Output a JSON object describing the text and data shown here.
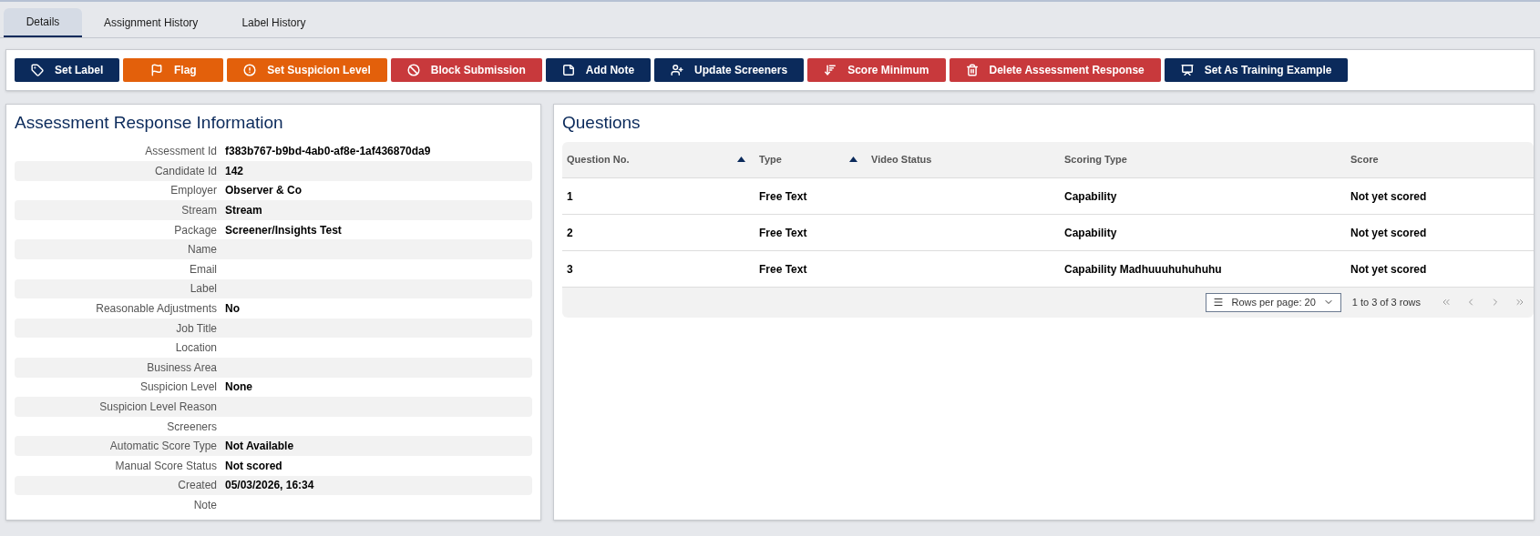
{
  "tabs": [
    {
      "label": "Details",
      "selected": true
    },
    {
      "label": "Assignment History",
      "selected": false
    },
    {
      "label": "Label History",
      "selected": false
    }
  ],
  "toolbar": [
    {
      "label": "Set Label",
      "kind": "primary"
    },
    {
      "label": "Flag",
      "kind": "warning"
    },
    {
      "label": "Set Suspicion Level",
      "kind": "warning"
    },
    {
      "label": "Block Submission",
      "kind": "danger"
    },
    {
      "label": "Add Note",
      "kind": "primary"
    },
    {
      "label": "Update Screeners",
      "kind": "primary"
    },
    {
      "label": "Score Minimum",
      "kind": "danger"
    },
    {
      "label": "Delete Assessment Response",
      "kind": "danger"
    },
    {
      "label": "Set As Training Example",
      "kind": "primary"
    }
  ],
  "info_panel": {
    "title": "Assessment Response Information",
    "fields": [
      {
        "label": "Assessment Id",
        "value": "f383b767-b9bd-4ab0-af8e-1af436870da9"
      },
      {
        "label": "Candidate Id",
        "value": "142"
      },
      {
        "label": "Employer",
        "value": "Observer & Co"
      },
      {
        "label": "Stream",
        "value": "Stream"
      },
      {
        "label": "Package",
        "value": "Screener/Insights Test"
      },
      {
        "label": "Name"
      },
      {
        "label": "Email"
      },
      {
        "label": "Label"
      },
      {
        "label": "Reasonable Adjustments",
        "value": "No"
      },
      {
        "label": "Job Title"
      },
      {
        "label": "Location"
      },
      {
        "label": "Business Area"
      },
      {
        "label": "Suspicion Level",
        "value": "None"
      },
      {
        "label": "Suspicion Level Reason"
      },
      {
        "label": "Screeners"
      },
      {
        "label": "Automatic Score Type",
        "value": "Not Available"
      },
      {
        "label": "Manual Score Status",
        "value": "Not scored"
      },
      {
        "label": "Created",
        "value": "05/03/2026, 16:34"
      },
      {
        "label": "Note"
      }
    ]
  },
  "questions": {
    "title": "Questions",
    "columns": [
      {
        "label": "Question No.",
        "sorted": true
      },
      {
        "label": "Type",
        "sorted": true
      },
      {
        "label": "Video Status",
        "sorted": false
      },
      {
        "label": "Scoring Type",
        "sorted": false
      },
      {
        "label": "Score",
        "sorted": false
      }
    ],
    "rows": [
      [
        "1",
        "Free Text",
        "",
        "Capability",
        "Not yet scored"
      ],
      [
        "2",
        "Free Text",
        "",
        "Capability",
        "Not yet scored"
      ],
      [
        "3",
        "Free Text",
        "",
        "Capability Madhuuuhuhuhuhu",
        "Not yet scored"
      ]
    ],
    "pagination": {
      "rows_per_page": "Rows per page: 20",
      "range": "1 to 3 of 3 rows"
    }
  }
}
